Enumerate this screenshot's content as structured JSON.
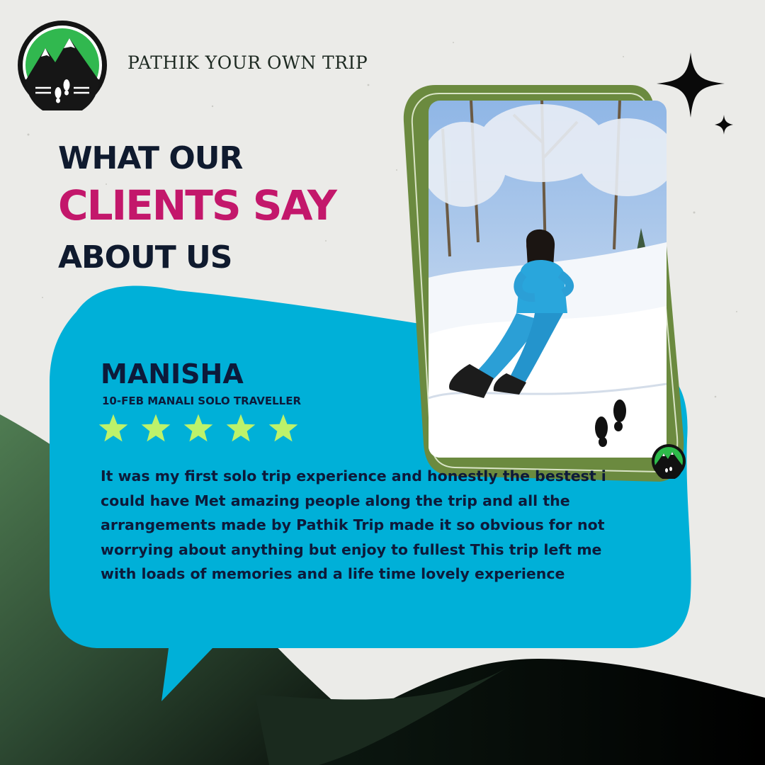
{
  "brand": {
    "name": "PATHIK YOUR OWN TRIP",
    "logo_icon": "mountain-footprints-logo"
  },
  "headline": {
    "line1": "WHAT OUR",
    "line2": "CLIENTS SAY",
    "line3": "ABOUT US"
  },
  "testimonial": {
    "name": "MANISHA",
    "subtitle": "10-FEB MANALI SOLO TRAVELLER",
    "rating": 5,
    "rating_max": 5,
    "text": "It was my first solo trip experience and honestly the bestest i could have Met amazing people along the trip and all the arrangements made by Pathik Trip made it so obvious for not worrying about anything but enjoy to fullest This trip left me with loads of memories and a life time lovely experience"
  },
  "photo": {
    "icon": "snow-photo-traveller",
    "overlay_icon": "footprints-icon"
  },
  "colors": {
    "accent_pink": "#c3176b",
    "bubble_blue": "#00b0d8",
    "frame_green": "#6b8a3f",
    "dark_green": "#3f6b45",
    "star_green": "#bdf26a",
    "navy_text": "#0d1a3a"
  }
}
